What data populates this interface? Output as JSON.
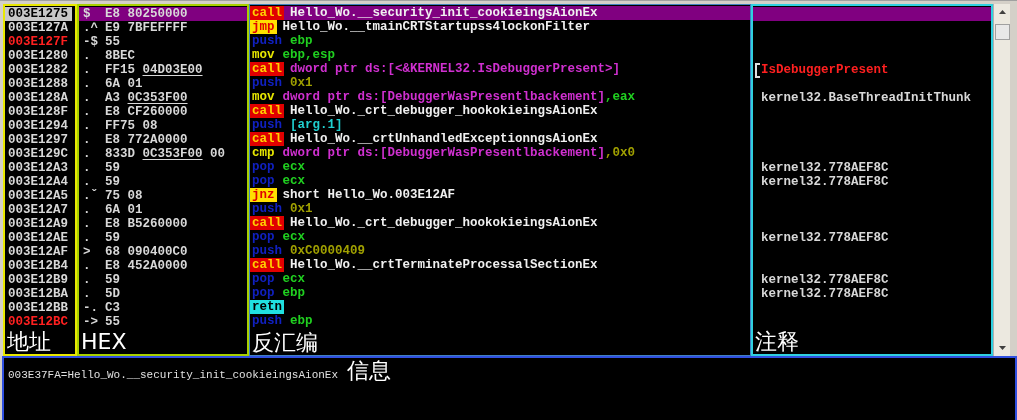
{
  "pane_labels": {
    "address": "地址",
    "hex": "HEX",
    "disassembly": "反汇编",
    "comment": "注释",
    "info": "信息"
  },
  "rows": [
    {
      "address": "003E1275",
      "entry": false,
      "selected": true,
      "mark": "$",
      "hex": [
        {
          "text": "E8 80250000",
          "underline": false
        }
      ],
      "mnemonic": "call",
      "kind": "call",
      "operands": [
        {
          "text": "Hello_Wo.__security_init_cookieingsAionEx",
          "kind": "label"
        }
      ]
    },
    {
      "address": "003E127A",
      "entry": false,
      "selected": false,
      "mark": ".^",
      "hex": [
        {
          "text": "E9 7BFEFFFF",
          "underline": false
        }
      ],
      "mnemonic": "jmp",
      "kind": "jump",
      "operands": [
        {
          "text": "Hello_Wo.__tmainCRTStartupss4lockonFilter",
          "kind": "label"
        }
      ]
    },
    {
      "address": "003E127F",
      "entry": true,
      "selected": false,
      "mark": "-$",
      "hex": [
        {
          "text": "55",
          "underline": false
        }
      ],
      "mnemonic": "push",
      "kind": "stack",
      "operands": [
        {
          "text": "ebp",
          "kind": "register"
        }
      ]
    },
    {
      "address": "003E1280",
      "entry": false,
      "selected": false,
      "mark": ".",
      "hex": [
        {
          "text": "8BEC",
          "underline": false
        }
      ],
      "mnemonic": "mov",
      "kind": "data",
      "operands": [
        {
          "text": "ebp,esp",
          "kind": "register"
        }
      ]
    },
    {
      "address": "003E1282",
      "entry": false,
      "selected": false,
      "mark": ".",
      "hex": [
        {
          "text": "FF15 ",
          "underline": false
        },
        {
          "text": "04D03E00",
          "underline": true
        }
      ],
      "mnemonic": "call",
      "kind": "call",
      "operands": [
        {
          "text": "dword ptr ds:[<&KERNEL32.IsDebuggerPresent>]",
          "kind": "memory"
        }
      ],
      "comment": {
        "text": "IsDebuggerPresent",
        "kind": "api"
      }
    },
    {
      "address": "003E1288",
      "entry": false,
      "selected": false,
      "mark": ".",
      "hex": [
        {
          "text": "6A 01",
          "underline": false
        }
      ],
      "mnemonic": "push",
      "kind": "stack",
      "operands": [
        {
          "text": "0x1",
          "kind": "immediate"
        }
      ]
    },
    {
      "address": "003E128A",
      "entry": false,
      "selected": false,
      "mark": ".",
      "hex": [
        {
          "text": "A3 ",
          "underline": false
        },
        {
          "text": "0C353F00",
          "underline": true
        }
      ],
      "mnemonic": "mov",
      "kind": "data",
      "operands": [
        {
          "text": "dword ptr ds:[DebuggerWasPresentlbackement]",
          "kind": "memory"
        },
        {
          "text": ",eax",
          "kind": "register"
        }
      ],
      "comment": {
        "text": "kernel32.BaseThreadInitThunk",
        "kind": "plain"
      }
    },
    {
      "address": "003E128F",
      "entry": false,
      "selected": false,
      "mark": ".",
      "hex": [
        {
          "text": "E8 CF260000",
          "underline": false
        }
      ],
      "mnemonic": "call",
      "kind": "call",
      "operands": [
        {
          "text": "Hello_Wo._crt_debugger_hookokieingsAionEx",
          "kind": "label"
        }
      ]
    },
    {
      "address": "003E1294",
      "entry": false,
      "selected": false,
      "mark": ".",
      "hex": [
        {
          "text": "FF75 08",
          "underline": false
        }
      ],
      "mnemonic": "push",
      "kind": "stack",
      "operands": [
        {
          "text": "[arg.1]",
          "kind": "argument"
        }
      ]
    },
    {
      "address": "003E1297",
      "entry": false,
      "selected": false,
      "mark": ".",
      "hex": [
        {
          "text": "E8 772A0000",
          "underline": false
        }
      ],
      "mnemonic": "call",
      "kind": "call",
      "operands": [
        {
          "text": "Hello_Wo.__crtUnhandledExceptionngsAionEx",
          "kind": "label"
        }
      ]
    },
    {
      "address": "003E129C",
      "entry": false,
      "selected": false,
      "mark": ".",
      "hex": [
        {
          "text": "833D ",
          "underline": false
        },
        {
          "text": "0C353F00",
          "underline": true
        },
        {
          "text": " 00",
          "underline": false
        }
      ],
      "mnemonic": "cmp",
      "kind": "data",
      "operands": [
        {
          "text": "dword ptr ds:[DebuggerWasPresentlbackement]",
          "kind": "memory"
        },
        {
          "text": ",0x0",
          "kind": "immediate"
        }
      ]
    },
    {
      "address": "003E12A3",
      "entry": false,
      "selected": false,
      "mark": ".",
      "hex": [
        {
          "text": "59",
          "underline": false
        }
      ],
      "mnemonic": "pop",
      "kind": "stack",
      "operands": [
        {
          "text": "ecx",
          "kind": "register"
        }
      ],
      "comment": {
        "text": "kernel32.778AEF8C",
        "kind": "plain"
      }
    },
    {
      "address": "003E12A4",
      "entry": false,
      "selected": false,
      "mark": ".",
      "hex": [
        {
          "text": "59",
          "underline": false
        }
      ],
      "mnemonic": "pop",
      "kind": "stack",
      "operands": [
        {
          "text": "ecx",
          "kind": "register"
        }
      ],
      "comment": {
        "text": "kernel32.778AEF8C",
        "kind": "plain"
      }
    },
    {
      "address": "003E12A5",
      "entry": false,
      "selected": false,
      "mark": ".ˇ",
      "hex": [
        {
          "text": "75 08",
          "underline": false
        }
      ],
      "mnemonic": "jnz",
      "kind": "jump",
      "operands": [
        {
          "text": "short Hello_Wo.003E12AF",
          "kind": "label"
        }
      ]
    },
    {
      "address": "003E12A7",
      "entry": false,
      "selected": false,
      "mark": ".",
      "hex": [
        {
          "text": "6A 01",
          "underline": false
        }
      ],
      "mnemonic": "push",
      "kind": "stack",
      "operands": [
        {
          "text": "0x1",
          "kind": "immediate"
        }
      ]
    },
    {
      "address": "003E12A9",
      "entry": false,
      "selected": false,
      "mark": ".",
      "hex": [
        {
          "text": "E8 B5260000",
          "underline": false
        }
      ],
      "mnemonic": "call",
      "kind": "call",
      "operands": [
        {
          "text": "Hello_Wo._crt_debugger_hookokieingsAionEx",
          "kind": "label"
        }
      ]
    },
    {
      "address": "003E12AE",
      "entry": false,
      "selected": false,
      "mark": ".",
      "hex": [
        {
          "text": "59",
          "underline": false
        }
      ],
      "mnemonic": "pop",
      "kind": "stack",
      "operands": [
        {
          "text": "ecx",
          "kind": "register"
        }
      ],
      "comment": {
        "text": "kernel32.778AEF8C",
        "kind": "plain"
      }
    },
    {
      "address": "003E12AF",
      "entry": false,
      "selected": false,
      "mark": ">",
      "hex": [
        {
          "text": "68 090400C0",
          "underline": false
        }
      ],
      "mnemonic": "push",
      "kind": "stack",
      "operands": [
        {
          "text": "0xC0000409",
          "kind": "immediate"
        }
      ]
    },
    {
      "address": "003E12B4",
      "entry": false,
      "selected": false,
      "mark": ".",
      "hex": [
        {
          "text": "E8 452A0000",
          "underline": false
        }
      ],
      "mnemonic": "call",
      "kind": "call",
      "operands": [
        {
          "text": "Hello_Wo.__crtTerminateProcessalSectionEx",
          "kind": "label"
        }
      ]
    },
    {
      "address": "003E12B9",
      "entry": false,
      "selected": false,
      "mark": ".",
      "hex": [
        {
          "text": "59",
          "underline": false
        }
      ],
      "mnemonic": "pop",
      "kind": "stack",
      "operands": [
        {
          "text": "ecx",
          "kind": "register"
        }
      ],
      "comment": {
        "text": "kernel32.778AEF8C",
        "kind": "plain"
      }
    },
    {
      "address": "003E12BA",
      "entry": false,
      "selected": false,
      "mark": ".",
      "hex": [
        {
          "text": "5D",
          "underline": false
        }
      ],
      "mnemonic": "pop",
      "kind": "stack",
      "operands": [
        {
          "text": "ebp",
          "kind": "register"
        }
      ],
      "comment": {
        "text": "kernel32.778AEF8C",
        "kind": "plain"
      }
    },
    {
      "address": "003E12BB",
      "entry": false,
      "selected": false,
      "mark": "-.",
      "hex": [
        {
          "text": "C3",
          "underline": false
        }
      ],
      "mnemonic": "retn",
      "kind": "return",
      "operands": []
    },
    {
      "address": "003E12BC",
      "entry": true,
      "selected": false,
      "mark": "->",
      "hex": [
        {
          "text": "55",
          "underline": false
        }
      ],
      "mnemonic": "push",
      "kind": "stack",
      "operands": [
        {
          "text": "ebp",
          "kind": "register"
        }
      ]
    }
  ],
  "info": {
    "text": "003E37FA=Hello_Wo.__security_init_cookieingsAionEx"
  }
}
